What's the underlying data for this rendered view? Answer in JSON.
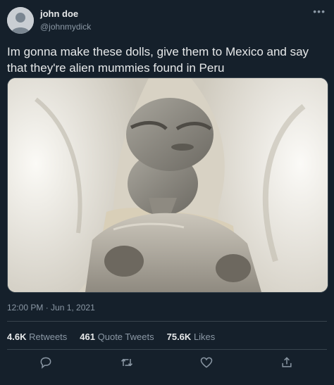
{
  "user": {
    "display_name": "john doe",
    "handle": "@johnmydick",
    "avatar_icon": "default-avatar-icon"
  },
  "tweet": {
    "text": "Im gonna make these dolls, give them to Mexico and say that they're alien mummies found in Peru",
    "timestamp": "12:00 PM · Jun 1, 2021",
    "media_description": "photo"
  },
  "stats": {
    "retweets_value": "4.6K",
    "retweets_label": "Retweets",
    "quotes_value": "461",
    "quotes_label": "Quote Tweets",
    "likes_value": "75.6K",
    "likes_label": "Likes"
  },
  "actions": {
    "reply_icon": "reply-icon",
    "retweet_icon": "retweet-icon",
    "like_icon": "heart-icon",
    "share_icon": "share-icon"
  },
  "colors": {
    "background": "#15202b",
    "text": "#e7e9ea",
    "muted": "#8b98a5",
    "divider": "#38444d"
  }
}
